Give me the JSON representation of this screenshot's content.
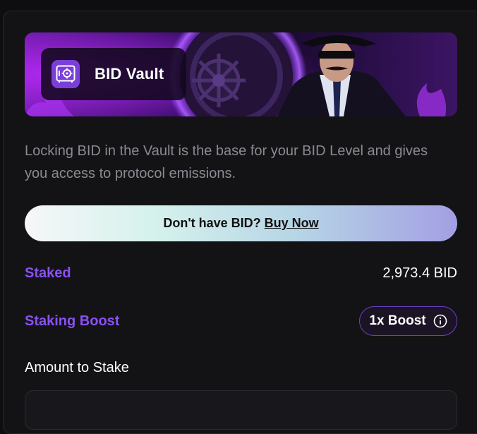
{
  "vault": {
    "title": "BID Vault",
    "icon": "vault-safe-icon"
  },
  "description": "Locking BID in the Vault is the base for your BID Level and gives you access to protocol emissions.",
  "buy": {
    "prompt": "Don't have BID?",
    "link_label": "Buy Now"
  },
  "staked": {
    "label": "Staked",
    "value": "2,973.4 BID"
  },
  "staking_boost": {
    "label": "Staking Boost",
    "value": "1x Boost",
    "icon": "info-icon"
  },
  "amount": {
    "label": "Amount to Stake",
    "placeholder": ""
  },
  "colors": {
    "accent": "#8b50f5",
    "background": "#131316",
    "muted_text": "#8a8a93"
  }
}
